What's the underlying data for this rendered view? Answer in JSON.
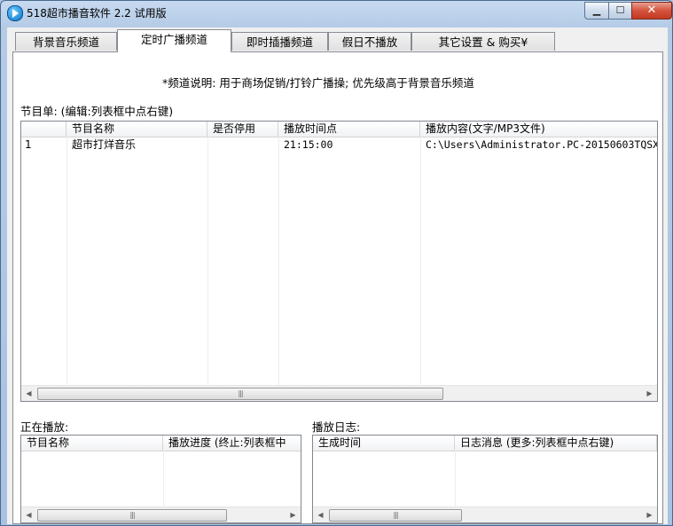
{
  "window": {
    "title": "518超市播音软件 2.2 试用版",
    "min_glyph": "▁",
    "max_glyph": "☐",
    "close_glyph": "✕"
  },
  "tabs": [
    {
      "label": "背景音乐频道",
      "active": false
    },
    {
      "label": "定时广播频道",
      "active": true
    },
    {
      "label": "即时插播频道",
      "active": false
    },
    {
      "label": "假日不播放",
      "active": false
    },
    {
      "label": "其它设置 & 购买¥",
      "active": false
    }
  ],
  "channel_desc": "*频道说明: 用于商场促销/打铃广播操; 优先级高于背景音乐频道",
  "program_list": {
    "label": "节目单: (编辑:列表框中点右键)",
    "columns": [
      "",
      "节目名称",
      "是否停用",
      "播放时间点",
      "播放内容(文字/MP3文件)"
    ],
    "rows": [
      {
        "num": "1",
        "name": "超市打烊音乐",
        "disabled": "",
        "time": "21:15:00",
        "content": "C:\\Users\\Administrator.PC-20150603TQSX"
      }
    ]
  },
  "now_playing": {
    "label": "正在播放:",
    "columns": [
      "节目名称",
      "播放进度 (终止:列表框中"
    ]
  },
  "play_log": {
    "label": "播放日志:",
    "columns": [
      "生成时间",
      "日志消息 (更多:列表框中点右键)"
    ]
  },
  "scroll_arrows": {
    "left": "◀",
    "right": "▶"
  },
  "scroll_grip": "|||",
  "colors": {
    "title_bar": "#b4cbe6",
    "close_button": "#d4523c",
    "panel_bg": "#f0f0f0"
  }
}
